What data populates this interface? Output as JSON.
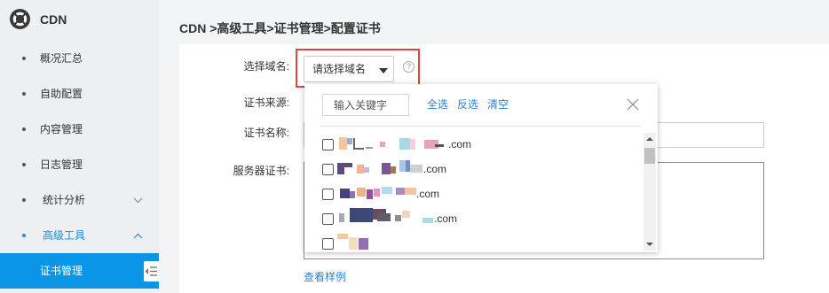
{
  "sidebar": {
    "logo_icon": "cdn-logo-icon",
    "title": "CDN",
    "items": [
      {
        "label": "概况汇总",
        "icon": "bullet-icon"
      },
      {
        "label": "自助配置",
        "icon": "bullet-icon"
      },
      {
        "label": "内容管理",
        "icon": "bullet-icon"
      },
      {
        "label": "日志管理",
        "icon": "bullet-icon"
      },
      {
        "label": "统计分析",
        "icon": "bullet-icon",
        "chevron": "chevron-down-icon",
        "expanded": false
      },
      {
        "label": "高级工具",
        "icon": "bullet-icon",
        "chevron": "chevron-up-icon",
        "expanded": true,
        "active": true,
        "children": [
          {
            "label": "证书管理",
            "selected": true
          }
        ]
      }
    ],
    "collapse_icon": "sidebar-collapse-icon"
  },
  "breadcrumb": "CDN >高级工具>证书管理>配置证书",
  "form": {
    "domain": {
      "label": "选择域名:",
      "select_text": "请选择域名",
      "caret_icon": "caret-down-icon",
      "help_icon": "help-icon"
    },
    "source": {
      "label": "证书来源:"
    },
    "name": {
      "label": "证书名称:",
      "value": ""
    },
    "server_cert": {
      "label": "服务器证书:",
      "value": ""
    },
    "view_example": "查看样例"
  },
  "domain_dropdown": {
    "search": {
      "placeholder": "输入关键字",
      "value": ""
    },
    "actions": {
      "select_all": "全选",
      "invert": "反选",
      "clear": "清空"
    },
    "close_icon": "close-icon",
    "items": [
      {
        "text": ".com",
        "checked": false
      },
      {
        "text": ".com",
        "checked": false
      },
      {
        "text": ".com",
        "checked": false
      },
      {
        "text": ".com",
        "checked": false
      },
      {
        "checked": false
      }
    ]
  },
  "colors": {
    "sidebar_bg": "#edeff2",
    "active_bg": "#0b95e6",
    "accent": "#1e8de0",
    "link": "#2b80d6",
    "highlight": "#e0453f"
  }
}
